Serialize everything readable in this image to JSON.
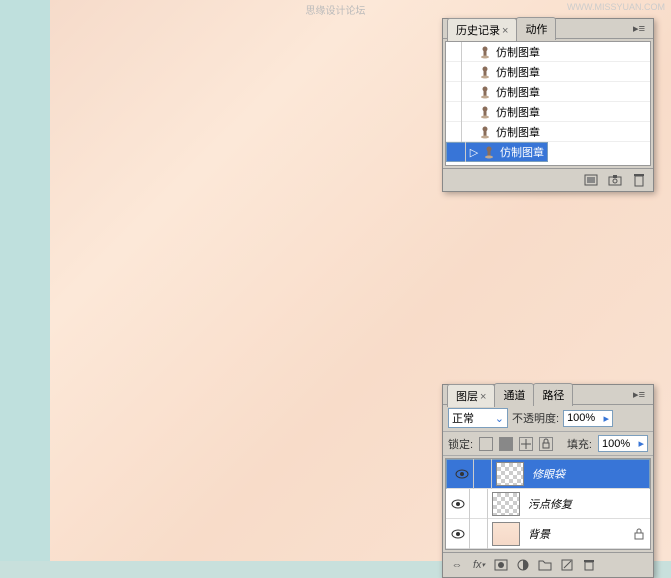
{
  "watermark": "思缘设计论坛",
  "url": "WWW.MISSYUAN.COM",
  "history_panel": {
    "tabs": [
      "历史记录",
      "动作"
    ],
    "active_tab": 0,
    "items": [
      {
        "label": "仿制图章"
      },
      {
        "label": "仿制图章"
      },
      {
        "label": "仿制图章"
      },
      {
        "label": "仿制图章"
      },
      {
        "label": "仿制图章"
      },
      {
        "label": "仿制图章"
      }
    ],
    "selected": 5
  },
  "layers_panel": {
    "tabs": [
      "图层",
      "通道",
      "路径"
    ],
    "active_tab": 0,
    "blend_mode": "正常",
    "opacity_label": "不透明度:",
    "opacity": "100%",
    "lock_label": "锁定:",
    "fill_label": "填充:",
    "fill": "100%",
    "layers": [
      {
        "name": "修眼袋",
        "thumb": "checker"
      },
      {
        "name": "污点修复",
        "thumb": "checker"
      },
      {
        "name": "背景",
        "thumb": "face",
        "locked": true
      }
    ],
    "selected": 0
  }
}
